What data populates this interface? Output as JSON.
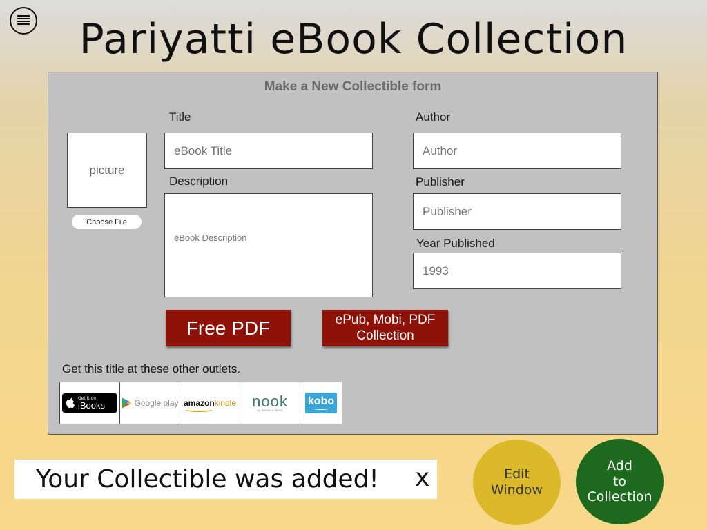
{
  "app": {
    "title": "Pariyatti eBook Collection",
    "menu_icon": "hamburger-menu-icon"
  },
  "form": {
    "heading": "Make a New Collectible form",
    "picture_placeholder": "picture",
    "choose_file_label": "Choose File",
    "title": {
      "label": "Title",
      "placeholder": "eBook Title",
      "value": ""
    },
    "description": {
      "label": "Description",
      "placeholder": "eBook Description",
      "value": ""
    },
    "author": {
      "label": "Author",
      "placeholder": "Author",
      "value": ""
    },
    "publisher": {
      "label": "Publisher",
      "placeholder": "Publisher",
      "value": ""
    },
    "year": {
      "label": "Year Published",
      "value": "1993"
    },
    "free_pdf_label": "Free PDF",
    "collection_line1": "ePub, Mobi, PDF",
    "collection_line2": "Collection",
    "outlets_label": "Get this title at these other outlets.",
    "outlets": [
      {
        "name": "iBooks",
        "small": "Get it on",
        "big": "iBooks"
      },
      {
        "name": "Google play",
        "text": "Google play"
      },
      {
        "name": "amazonkindle",
        "brand": "amazon",
        "product": "kindle"
      },
      {
        "name": "nook",
        "text": "nook",
        "sub": "by Barnes & Noble"
      },
      {
        "name": "kobo",
        "text": "kobo"
      }
    ]
  },
  "toast": {
    "message": "Your Collectible was added!",
    "close_label": "x"
  },
  "buttons": {
    "edit_window_line1": "Edit",
    "edit_window_line2": "Window",
    "add_line1": "Add",
    "add_line2": "to",
    "add_line3": "Collection"
  },
  "colors": {
    "accent_red": "#8e1208",
    "edit_yellow": "#dbb92b",
    "add_green": "#1d6a1f",
    "form_gray": "#c1c1c1",
    "kobo_blue": "#3aa6d7"
  }
}
